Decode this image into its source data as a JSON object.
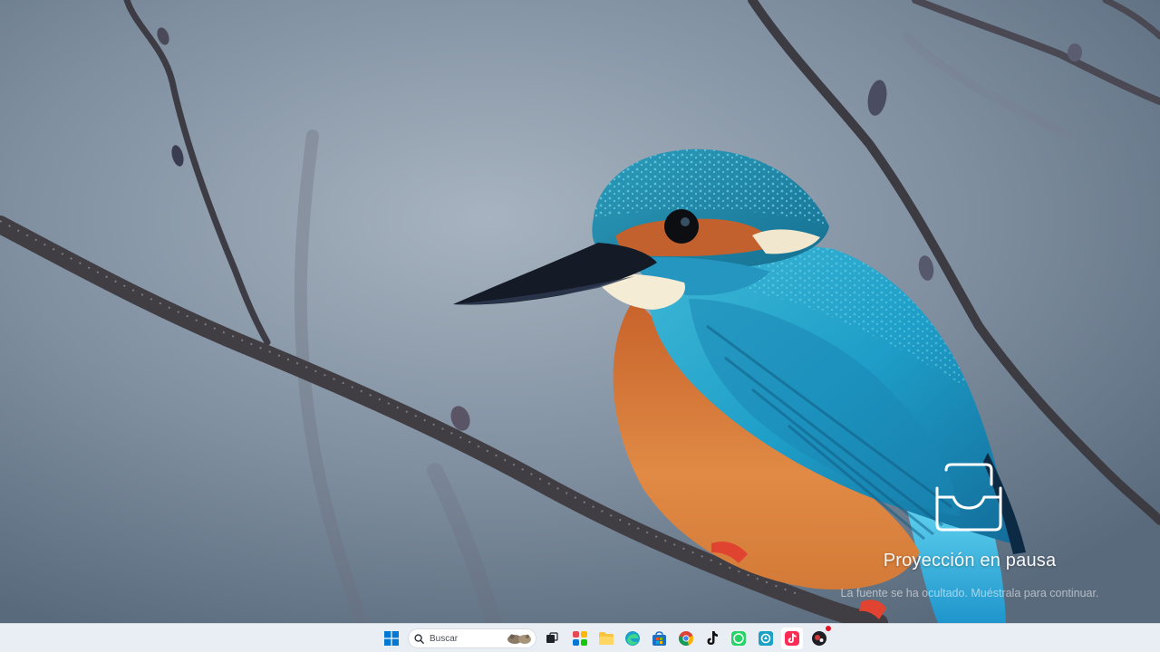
{
  "overlay": {
    "title": "Proyección en pausa",
    "subtitle": "La fuente se ha ocultado. Muéstrala para continuar."
  },
  "taskbar": {
    "search_placeholder": "Buscar",
    "icons": [
      "windows-start-icon",
      "search-icon",
      "task-view-icon",
      "widgets-icon",
      "file-explorer-icon",
      "edge-icon",
      "store-icon",
      "chrome-icon",
      "tiktok-icon",
      "whatsapp-icon",
      "maps-icon",
      "tiktok-app-icon",
      "game-app-icon"
    ],
    "colors": {
      "background": "#e9eef5",
      "windows_blue": "#0078d4",
      "notification_badge": "#e81123"
    }
  }
}
